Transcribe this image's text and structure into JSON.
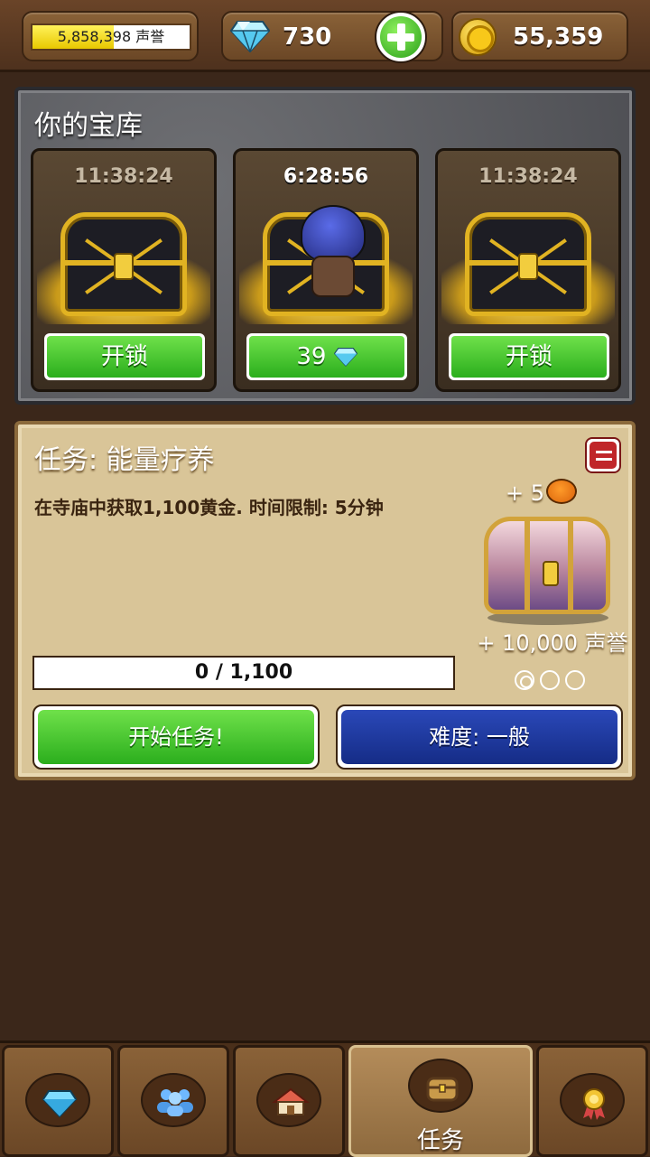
{
  "topbar": {
    "reputation_text": "5,858,398 声誉",
    "reputation_progress": 0.52,
    "gems": "730",
    "gold": "55,359"
  },
  "vault": {
    "title": "你的宝库",
    "slots": [
      {
        "timer": "11:38:24",
        "button": "开锁",
        "state": "locked"
      },
      {
        "timer": "6:28:56",
        "button_value": "39",
        "state": "unlocking"
      },
      {
        "timer": "11:38:24",
        "button": "开锁",
        "state": "locked"
      }
    ]
  },
  "quest": {
    "title": "任务: 能量疗养",
    "description": "在寺庙中获取1,100黄金. 时间限制: 5分钟",
    "bonus": "+ 5",
    "reward_reputation": "+ 10,000 声誉",
    "difficulty_stars": "◎○○",
    "progress_text": "0 / 1,100",
    "progress": 0,
    "start_button": "开始任务!",
    "difficulty_button": "难度: 一般"
  },
  "nav": {
    "tabs": [
      {
        "icon": "gem-shop-icon"
      },
      {
        "icon": "guild-icon"
      },
      {
        "icon": "village-icon"
      },
      {
        "icon": "treasure-chest-icon",
        "label": "任务",
        "active": true
      },
      {
        "icon": "achievement-medal-icon"
      }
    ]
  },
  "colors": {
    "wood": "#6b4726",
    "green_button": "#2bae1d",
    "blue_button": "#152c86",
    "parchment": "#d9c598"
  }
}
